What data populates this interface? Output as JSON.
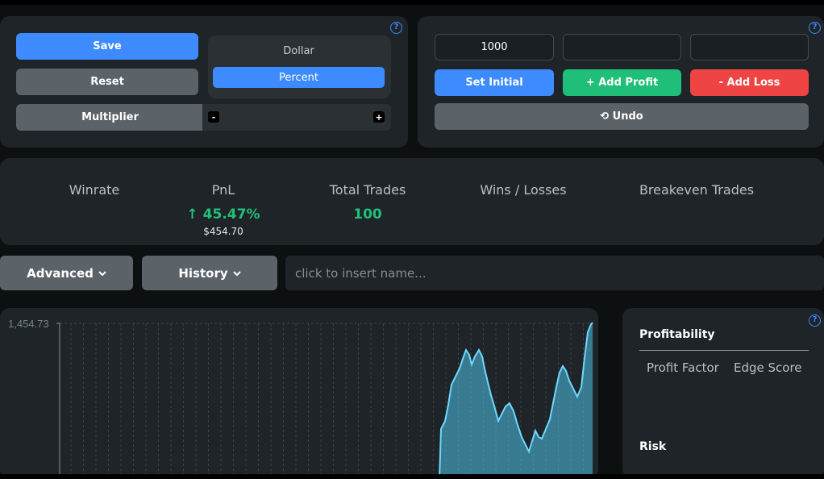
{
  "controls": {
    "save_label": "Save",
    "reset_label": "Reset",
    "multiplier_label": "Multiplier",
    "mode_options": [
      "Dollar",
      "Percent"
    ],
    "mode_selected": "Percent",
    "minus_label": "-",
    "plus_label": "+"
  },
  "balance": {
    "initial_value": "1000",
    "profit_value": "",
    "loss_value": "",
    "set_initial_label": "Set Initial",
    "add_profit_label": "+ Add Profit",
    "add_loss_label": "- Add Loss",
    "undo_label": "⟲ Undo"
  },
  "stats": {
    "winrate_label": "Winrate",
    "pnl_label": "PnL",
    "pnl_value": "↑ 45.47%",
    "pnl_dollar": "$454.70",
    "total_trades_label": "Total Trades",
    "total_trades_value": "100",
    "wins_losses_label": "Wins / Losses",
    "breakeven_label": "Breakeven Trades"
  },
  "toolbar": {
    "advanced_label": "Advanced",
    "history_label": "History",
    "name_placeholder": "click to insert name..."
  },
  "chart_data": {
    "type": "area",
    "y_tick_labels": [
      "1,454.73"
    ],
    "ymax": 1454.73,
    "color": "#4fc3e8"
  },
  "metrics": {
    "profitability_title": "Profitability",
    "profit_factor_label": "Profit Factor",
    "edge_score_label": "Edge Score",
    "risk_title": "Risk"
  },
  "help_icon": "?",
  "colors": {
    "blue": "#3d8bff",
    "green": "#1fbf7a",
    "red": "#ef4444",
    "grey": "#5b6268"
  }
}
